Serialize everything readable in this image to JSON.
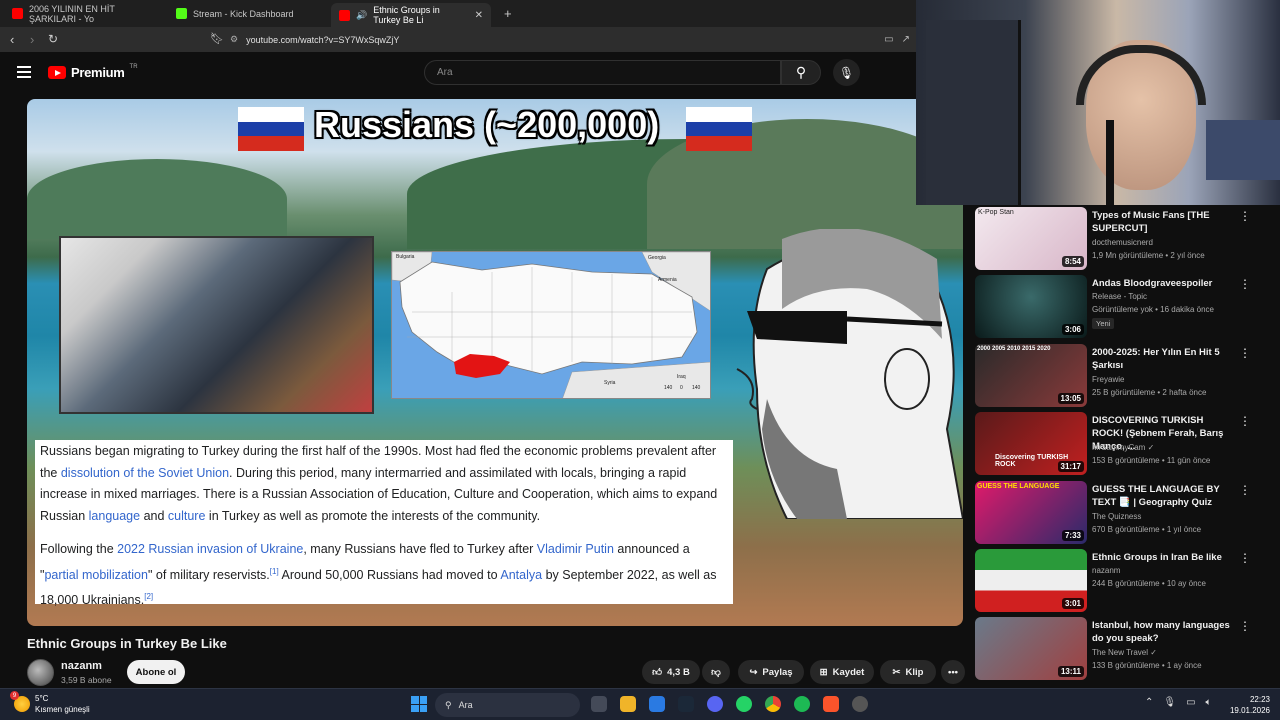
{
  "browser": {
    "tabs": [
      {
        "title": "2006 YILININ EN HİT ŞARKILARI - Yo",
        "favicon_color": "#ff0000"
      },
      {
        "title": "Stream - Kick Dashboard",
        "favicon_color": "#53fc18"
      },
      {
        "title": "Ethnic Groups in Turkey Be Li",
        "favicon_color": "#ff0000",
        "active": true
      }
    ],
    "new_tab": "+",
    "close": "✕",
    "url": "youtube.com/watch?v=SY7WxSqwZjY"
  },
  "youtube": {
    "logo_text": "Premium",
    "logo_suffix": "TR",
    "search_placeholder": "Ara"
  },
  "video": {
    "overlay_title": "Russians (~200,000)",
    "map_labels": {
      "bulgaria": "Bulgaria",
      "georgia": "Georgia",
      "armenia": "Armenia",
      "syria": "Syria",
      "iraq": "Iraq",
      "scale1": "140",
      "scale2": "0",
      "scale3": "140"
    },
    "paragraph1": {
      "t1": "Russians began migrating to Turkey during the first half of the 1990s. Most had fled the economic problems prevalent after the ",
      "l1": "dissolution of the Soviet Union",
      "t2": ". During this period, many intermarried and assimilated with locals, bringing a rapid increase in mixed marriages. There is a Russian Association of Education, Culture and Cooperation, which aims to expand Russian ",
      "l2": "language",
      "t3": " and ",
      "l3": "culture",
      "t4": " in Turkey as well as promote the interests of the community."
    },
    "paragraph2": {
      "t1": "Following the ",
      "l1": "2022 Russian invasion of Ukraine",
      "t2": ", many Russians have fled to Turkey after ",
      "l2": "Vladimir Putin",
      "t3": " announced a \"",
      "l3": "partial mobilization",
      "t4": "\" of military reservists.",
      "ref1": "[1]",
      "t5": " Around 50,000 Russians had moved to ",
      "l4": "Antalya",
      "t6": " by September 2022, as well as 18,000 Ukrainians.",
      "ref2": "[2]"
    }
  },
  "video_info": {
    "title": "Ethnic Groups in Turkey Be Like",
    "channel": "nazanm",
    "subscribers": "3,59 B abone",
    "subscribe_label": "Abone ol",
    "like_count": "4,3 B",
    "share_label": "Paylaş",
    "save_label": "Kaydet",
    "clip_label": "Klip",
    "more_label": "•••"
  },
  "recommendations": [
    {
      "title": "Types of Music Fans [THE SUPERCUT]",
      "channel": "docthemusicnerd",
      "meta": "1,9 Mn görüntüleme • 2 yıl önce",
      "duration": "8:54",
      "thumb_colors": [
        "#f3e9ef",
        "#d8b6c8"
      ],
      "thumb_text": "K-Pop Stan"
    },
    {
      "title": "Andas Bloodgraveespoiler",
      "channel": "Release - Topic",
      "meta": "Görüntüleme yok • 16 dakika önce",
      "badge": "Yeni",
      "duration": "3:06",
      "thumb_colors": [
        "#0a1a1a",
        "#1e3a3a"
      ]
    },
    {
      "title": "2000-2025: Her Yılın En Hit 5 Şarkısı",
      "channel": "Freyawie",
      "meta": "25 B görüntüleme • 2 hafta önce",
      "duration": "13:05",
      "thumb_colors": [
        "#2a2a2a",
        "#8a3a3a"
      ],
      "thumb_text": "2000 2005 2010 2015 2020"
    },
    {
      "title": "DISCOVERING TURKISH ROCK! (Şebnem Ferah, Barış Manço, ...",
      "channel": "MrSammyCam",
      "channel_verified": "✓",
      "meta": "153 B görüntüleme • 11 gün önce",
      "duration": "31:17",
      "thumb_colors": [
        "#5a1a1a",
        "#c02020"
      ],
      "thumb_text": "Discovering TURKISH ROCK"
    },
    {
      "title": "GUESS THE LANGUAGE BY TEXT 📑 | Geography Quiz",
      "channel": "The Quizness",
      "meta": "670 B görüntüleme • 1 yıl önce",
      "duration": "7:33",
      "thumb_colors": [
        "#e01a6a",
        "#2a2a6a"
      ],
      "thumb_text": "GUESS THE LANGUAGE"
    },
    {
      "title": "Ethnic Groups in Iran Be like",
      "channel": "nazanm",
      "meta": "244 B görüntüleme • 10 ay önce",
      "duration": "3:01",
      "thumb_colors": [
        "#2a9a3a",
        "#e0e0e0"
      ]
    },
    {
      "title": "Istanbul, how many languages do you speak?",
      "channel": "The New Travel",
      "channel_verified": "✓",
      "meta": "133 B görüntüleme • 1 ay önce",
      "duration": "13:11",
      "thumb_colors": [
        "#6a7a8a",
        "#a04040"
      ]
    }
  ],
  "taskbar": {
    "temperature": "5°C",
    "weather": "Kısmen güneşli",
    "search_placeholder": "Ara",
    "time": "22:23",
    "date": "19.01.2026",
    "notif_count": "9"
  }
}
